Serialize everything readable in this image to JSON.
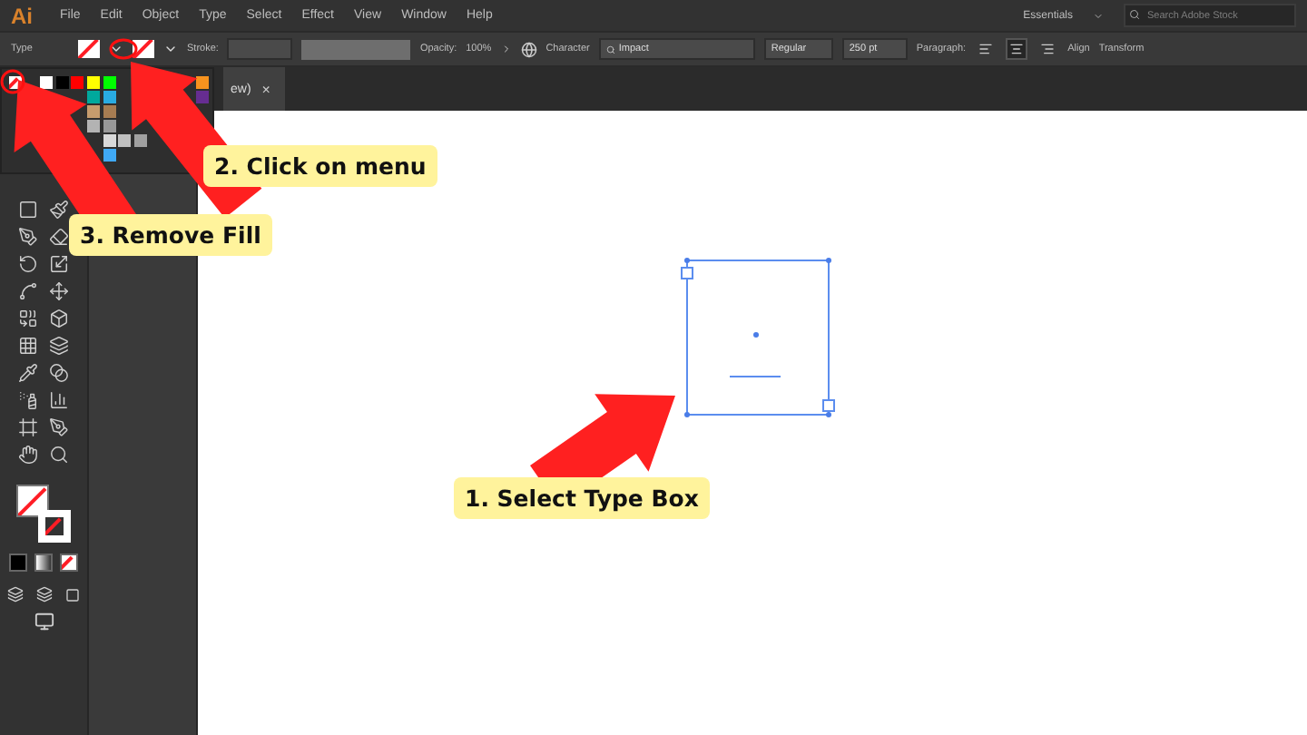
{
  "app": {
    "logo": "Ai",
    "menus": [
      "File",
      "Edit",
      "Object",
      "Type",
      "Select",
      "Effect",
      "View",
      "Window",
      "Help"
    ],
    "workspace": "Essentials",
    "search": {
      "placeholder": "Search Adobe Stock"
    }
  },
  "control_bar": {
    "label": "Type",
    "stroke_label": "Stroke:",
    "opacity_label": "Opacity:",
    "opacity": "100%",
    "character": "Character",
    "font": "Impact",
    "style": "Regular",
    "size": "250 pt",
    "paragraph": "Paragraph:",
    "align_buttons": [
      {
        "selected": false
      },
      {
        "selected": true
      },
      {
        "selected": false
      }
    ],
    "align": "Align",
    "transform": "Transform"
  },
  "document_tab": {
    "title": "ew)",
    "close": "×"
  },
  "swatches": [
    {
      "kind": "none"
    },
    {
      "kind": "covered"
    },
    {
      "kind": "color",
      "color": "#ffffff"
    },
    {
      "kind": "color",
      "color": "#000000"
    },
    {
      "kind": "color",
      "color": "#ff0000"
    },
    {
      "kind": "color",
      "color": "#ffff00"
    },
    {
      "kind": "color",
      "color": "#00ff00"
    },
    {
      "kind": "covered"
    },
    {
      "kind": "covered"
    },
    {
      "kind": "covered"
    },
    {
      "kind": "covered"
    },
    {
      "kind": "covered"
    },
    {
      "kind": "color",
      "color": "#f7931e"
    },
    {
      "kind": "covered"
    },
    {
      "kind": "covered"
    },
    {
      "kind": "covered"
    },
    {
      "kind": "covered"
    },
    {
      "kind": "covered"
    },
    {
      "kind": "color",
      "color": "#00a99d"
    },
    {
      "kind": "color",
      "color": "#29abe2"
    },
    {
      "kind": "covered"
    },
    {
      "kind": "covered"
    },
    {
      "kind": "covered"
    },
    {
      "kind": "covered"
    },
    {
      "kind": "covered"
    },
    {
      "kind": "color",
      "color": "#662d91"
    },
    {
      "kind": "covered"
    },
    {
      "kind": "covered"
    },
    {
      "kind": "covered"
    },
    {
      "kind": "covered"
    },
    {
      "kind": "covered"
    },
    {
      "kind": "color",
      "color": "#c69c6d"
    },
    {
      "kind": "color",
      "color": "#a67c52"
    },
    {
      "kind": "covered"
    },
    {
      "kind": "covered"
    },
    {
      "kind": "covered"
    },
    {
      "kind": "covered"
    },
    {
      "kind": "covered"
    },
    {
      "kind": "covered"
    },
    {
      "kind": "covered"
    },
    {
      "kind": "covered"
    },
    {
      "kind": "covered"
    },
    {
      "kind": "covered"
    },
    {
      "kind": "covered"
    },
    {
      "kind": "color",
      "color": "#b3b3b3"
    },
    {
      "kind": "color",
      "color": "#999999"
    },
    {
      "kind": "covered"
    },
    {
      "kind": "covered"
    },
    {
      "kind": "covered"
    },
    {
      "kind": "covered"
    },
    {
      "kind": "covered"
    },
    {
      "kind": "covered"
    },
    {
      "kind": "covered"
    },
    {
      "kind": "covered"
    },
    {
      "kind": "covered"
    },
    {
      "kind": "covered"
    },
    {
      "kind": "covered"
    },
    {
      "kind": "covered"
    },
    {
      "kind": "color",
      "color": "#d9d9d9"
    },
    {
      "kind": "color",
      "color": "#c0c0c0"
    },
    {
      "kind": "color",
      "color": "#a0a0a0"
    },
    {
      "kind": "covered"
    },
    {
      "kind": "covered"
    },
    {
      "kind": "covered"
    },
    {
      "kind": "covered"
    },
    {
      "kind": "covered"
    },
    {
      "kind": "covered"
    },
    {
      "kind": "covered"
    },
    {
      "kind": "covered"
    },
    {
      "kind": "covered"
    },
    {
      "kind": "covered"
    },
    {
      "kind": "color",
      "color": "#3fa9f5"
    }
  ],
  "callouts": [
    {
      "text": "2. Click on menu"
    },
    {
      "text": "3. Remove Fill"
    },
    {
      "text": "1. Select Type Box"
    }
  ]
}
